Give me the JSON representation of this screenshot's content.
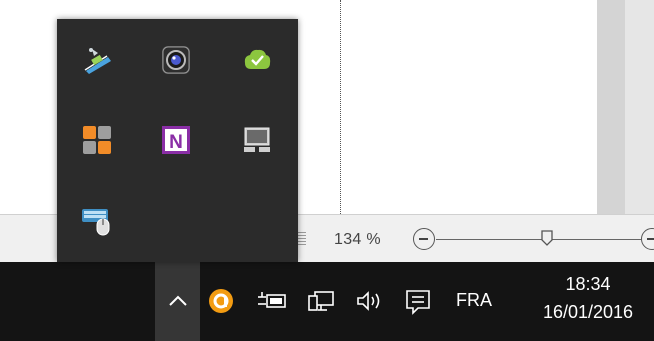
{
  "status_bar": {
    "zoom_percent": "134 %",
    "zoom_minus_icon": "minus-circle-icon",
    "zoom_plus_icon": "plus-circle-icon",
    "zoom_level_fraction": 0.51
  },
  "tray_overflow": {
    "icons": [
      {
        "name": "network-usb-icon"
      },
      {
        "name": "webcam-icon"
      },
      {
        "name": "green-check-cloud-icon"
      },
      {
        "name": "color-tiles-icon"
      },
      {
        "name": "onenote-icon",
        "letter": "N"
      },
      {
        "name": "display-devices-icon"
      },
      {
        "name": "keyboard-mouse-icon"
      }
    ]
  },
  "taskbar": {
    "chevron_icon": "chevron-up-icon",
    "tray_icons": [
      "orange-circle-app-icon",
      "power-plug-icon",
      "network-icon",
      "volume-icon",
      "action-center-icon"
    ],
    "language": "FRA",
    "time": "18:34",
    "date": "16/01/2016"
  },
  "colors": {
    "taskbar_bg": "#141414",
    "flyout_bg": "#2b2b2b",
    "accent_orange": "#f39c12",
    "onenote_purple": "#8a2ea6"
  }
}
